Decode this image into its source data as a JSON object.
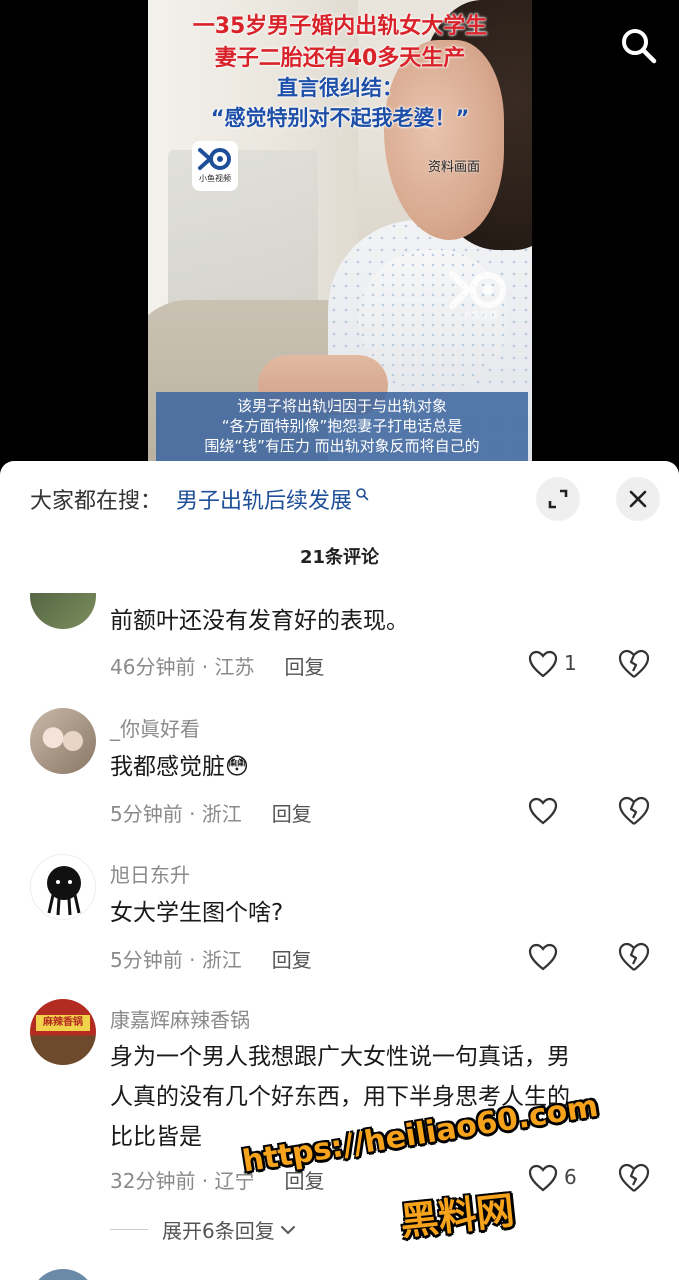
{
  "video": {
    "headline_red_1": "一35岁男子婚内出轨女大学生",
    "headline_red_2": "妻子二胎还有40多天生产",
    "headline_blue_1": "直言很纠结：",
    "headline_blue_2": "“感觉特别对不起我老婆！”",
    "logo_caption": "小鱼视频",
    "source_note": "资料画面",
    "subtitle_lines": [
      "该男子将出轨归因于与出轨对象",
      "“各方面特别像”抱怨妻子打电话总是",
      "围绕“钱”有压力 而出轨对象反而将自己的"
    ],
    "search_icon": "search-icon"
  },
  "sheet": {
    "search_label": "大家都在搜：",
    "search_term": "男子出轨后续发展",
    "comment_count": "21条评论",
    "expand_icon": "expand-icon",
    "close_icon": "close-icon"
  },
  "comments": [
    {
      "username": "",
      "text": "前额叶还没有发育好的表现。",
      "time": "46分钟前 · 江苏",
      "reply": "回复",
      "likes": "1"
    },
    {
      "username": "_你眞好看",
      "text": "我都感觉脏",
      "emoji": "😳",
      "time": "5分钟前 · 浙江",
      "reply": "回复",
      "likes": ""
    },
    {
      "username": "旭日东升",
      "text": "女大学生图个啥?",
      "time": "5分钟前 · 浙江",
      "reply": "回复",
      "likes": ""
    },
    {
      "username": "康嘉辉麻辣香锅",
      "text_lines": [
        "身为一个男人我想跟广大女性说一句真话，男",
        "人真的没有几个好东西，用下半身思考人生的",
        "比比皆是"
      ],
      "avatar_sign": "麻辣香锅",
      "time": "32分钟前 · 辽宁",
      "reply": "回复",
      "likes": "6"
    }
  ],
  "expand_replies": "展开6条回复",
  "watermark": {
    "url": "https://heiliao60.com",
    "name": "黑料网"
  },
  "colors": {
    "link_blue": "#1f4f98",
    "headline_red": "#d8232a",
    "headline_blue": "#1d4fa8",
    "watermark_orange": "#f6a21a"
  }
}
